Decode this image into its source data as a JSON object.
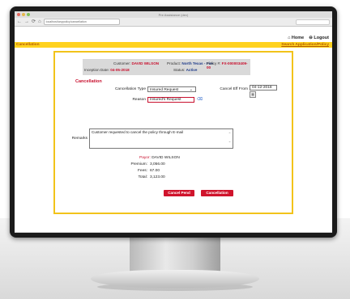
{
  "browser": {
    "tab_title": "Pre Assistance (dev)",
    "url": "localhost/anypolicy/cancellation",
    "nav": [
      "←",
      "→",
      "⟳",
      "⌂"
    ]
  },
  "top_links": {
    "home": "⌂ Home",
    "logout": "⊖ Logout"
  },
  "header": {
    "section": "Cancellation",
    "search_link": "Search Application/Policy"
  },
  "info": {
    "customer_label": "Customer:",
    "customer_value": "DAVID WILSON",
    "product_label": "Product:",
    "product_value": "North Texas - Fire",
    "policy_label": "Policy #:",
    "policy_value": "FX-000003409-00",
    "inception_label": "Inception Date:",
    "inception_value": "04-05-2018",
    "status_label": "Status:",
    "status_value": "Active"
  },
  "form": {
    "title": "Cancellation",
    "type_label": "Cancellation Type",
    "type_value": "Insured Request",
    "eff_label": "Cancel Eff From",
    "eff_value": "04-12-2018",
    "reason_label": "Reason",
    "reason_value": "Insured's Request",
    "remarks_label": "Remarks",
    "remarks_value": "Customer requested to cancel the policy through E-mail"
  },
  "summary": {
    "payor_label": "Payor:",
    "payor_value": "DAVID WILSON",
    "premium_label": "Premium:",
    "premium_value": "3,056.00",
    "fees_label": "Fees:",
    "fees_value": "67.00",
    "total_label": "Total:",
    "total_value": "3,123.00"
  },
  "buttons": {
    "cancel_pend": "Cancel Pend",
    "cancellation": "Cancellation"
  },
  "colors": {
    "accent_yellow": "#ffd21f",
    "accent_red": "#d0142c",
    "link_blue": "#2a64c9"
  }
}
